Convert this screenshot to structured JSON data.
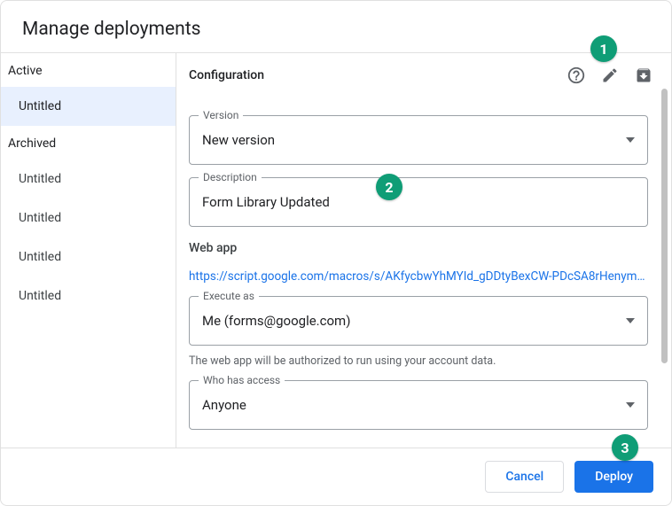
{
  "dialog": {
    "title": "Manage deployments"
  },
  "sidebar": {
    "active_heading": "Active",
    "archived_heading": "Archived",
    "active_items": [
      {
        "label": "Untitled",
        "selected": true
      }
    ],
    "archived_items": [
      {
        "label": "Untitled"
      },
      {
        "label": "Untitled"
      },
      {
        "label": "Untitled"
      },
      {
        "label": "Untitled"
      }
    ]
  },
  "config": {
    "heading": "Configuration",
    "version_label": "Version",
    "version_value": "New version",
    "description_label": "Description",
    "description_value": "Form Library Updated",
    "webapp_heading": "Web app",
    "webapp_url": "https://script.google.com/macros/s/AKfycbwYhMYId_gDDtyBexCW-PDcSA8rHenymp…",
    "execute_as_label": "Execute as",
    "execute_as_value": "Me (forms@google.com)",
    "execute_as_hint": "The web app will be authorized to run using your account data.",
    "access_label": "Who has access",
    "access_value": "Anyone"
  },
  "footer": {
    "cancel": "Cancel",
    "deploy": "Deploy"
  },
  "annotations": {
    "b1": "1",
    "b2": "2",
    "b3": "3"
  }
}
